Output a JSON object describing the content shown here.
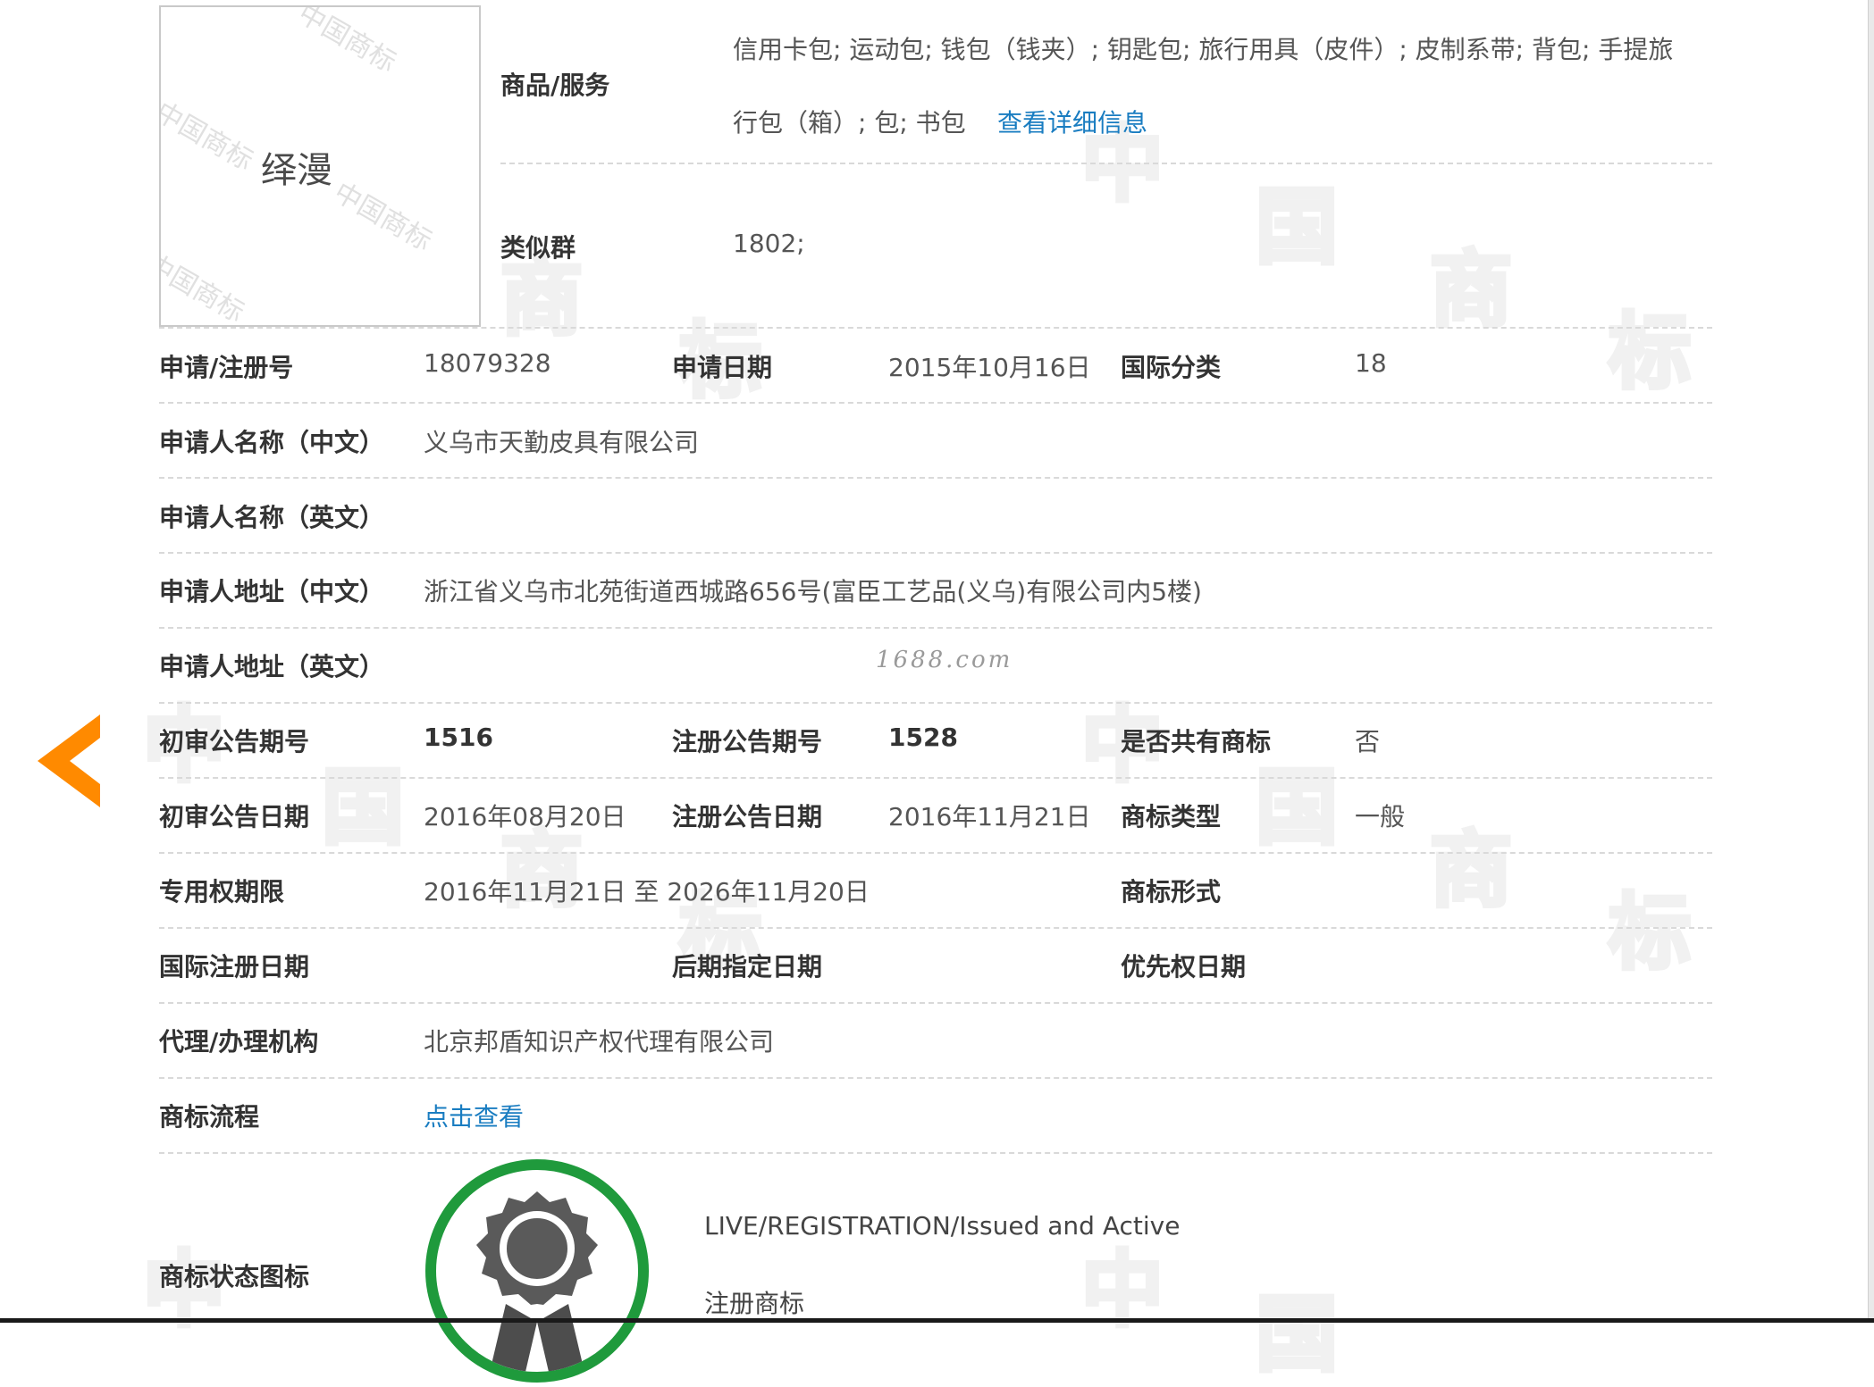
{
  "logo": {
    "text": "绎漫"
  },
  "goods": {
    "label": "商品/服务",
    "line1": "信用卡包; 运动包; 钱包（钱夹）; 钥匙包; 旅行用具（皮件）; 皮制系带; 背包; 手提旅",
    "line2": "行包（箱）; 包; 书包",
    "detail_link": "查看详细信息"
  },
  "similar_group": {
    "label": "类似群",
    "value": "1802;"
  },
  "rows": {
    "reg_no": {
      "label": "申请/注册号",
      "value": "18079328"
    },
    "apply_date": {
      "label": "申请日期",
      "value": "2015年10月16日"
    },
    "intl_class": {
      "label": "国际分类",
      "value": "18"
    },
    "applicant_cn": {
      "label": "申请人名称（中文）",
      "value": "义乌市天勤皮具有限公司"
    },
    "applicant_en": {
      "label": "申请人名称（英文）",
      "value": ""
    },
    "address_cn": {
      "label": "申请人地址（中文）",
      "value": "浙江省义乌市北苑街道西城路656号(富臣工艺品(义乌)有限公司内5楼)"
    },
    "address_en": {
      "label": "申请人地址（英文）",
      "value": ""
    },
    "prelim_issue": {
      "label": "初审公告期号",
      "value": "1516"
    },
    "reg_issue": {
      "label": "注册公告期号",
      "value": "1528"
    },
    "shared_mark": {
      "label": "是否共有商标",
      "value": "否"
    },
    "prelim_date": {
      "label": "初审公告日期",
      "value": "2016年08月20日"
    },
    "reg_date": {
      "label": "注册公告日期",
      "value": "2016年11月21日"
    },
    "mark_type": {
      "label": "商标类型",
      "value": "一般"
    },
    "exclusive_period": {
      "label": "专用权期限",
      "value": "2016年11月21日 至 2026年11月20日"
    },
    "mark_form": {
      "label": "商标形式",
      "value": ""
    },
    "intl_reg_date": {
      "label": "国际注册日期",
      "value": ""
    },
    "later_date": {
      "label": "后期指定日期",
      "value": ""
    },
    "priority_date": {
      "label": "优先权日期",
      "value": ""
    },
    "agency": {
      "label": "代理/办理机构",
      "value": "北京邦盾知识产权代理有限公司"
    },
    "process": {
      "label": "商标流程",
      "link": "点击查看"
    },
    "status_icon": {
      "label": "商标状态图标",
      "status_en": "LIVE/REGISTRATION/Issued and Active",
      "status_cn": "注册商标"
    }
  },
  "watermark": {
    "site": "1688.com"
  },
  "colors": {
    "link": "#1a7dc1",
    "arrow": "#ff8a00",
    "seal": "#1f9a3c"
  }
}
